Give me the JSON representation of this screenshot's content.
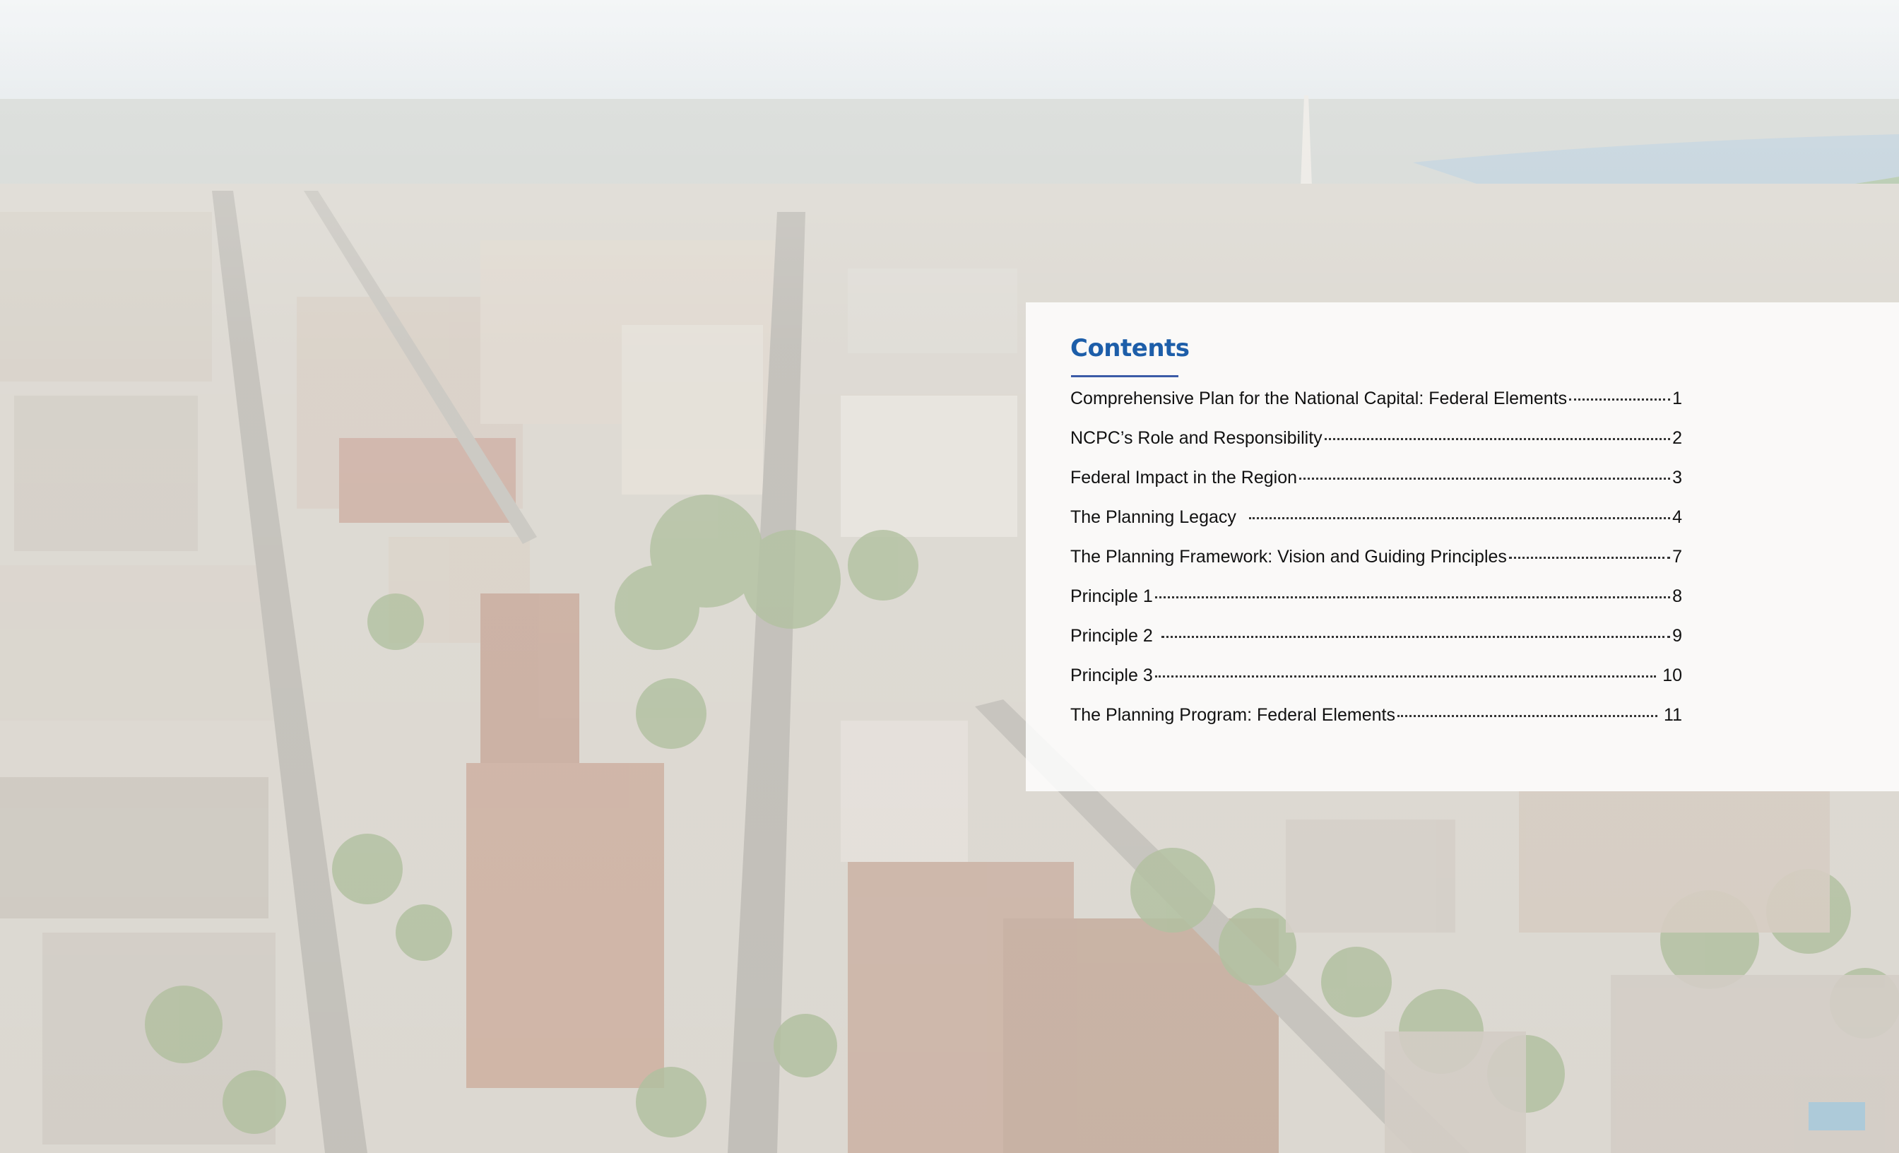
{
  "contents": {
    "title": "Contents",
    "entries": [
      {
        "label": "Comprehensive Plan for the National Capital: Federal Elements",
        "page": "1"
      },
      {
        "label": "NCPC’s Role and Responsibility",
        "page": "2"
      },
      {
        "label": "Federal Impact in the Region",
        "page": "3"
      },
      {
        "label": "The Planning Legacy",
        "page": "4"
      },
      {
        "label": "The Planning Framework: Vision and Guiding Principles",
        "page": "7"
      },
      {
        "label": "Principle 1",
        "page": "8"
      },
      {
        "label": "Principle 2",
        "page": "9"
      },
      {
        "label": "Principle 3",
        "page": "10"
      },
      {
        "label": "The Planning Program: Federal Elements",
        "page": "11"
      }
    ]
  },
  "colors": {
    "title": "#1d5ea9",
    "rule": "#3b5ba7",
    "panel": "#ffffff"
  },
  "background": {
    "icon": "aerial-city-photo"
  }
}
